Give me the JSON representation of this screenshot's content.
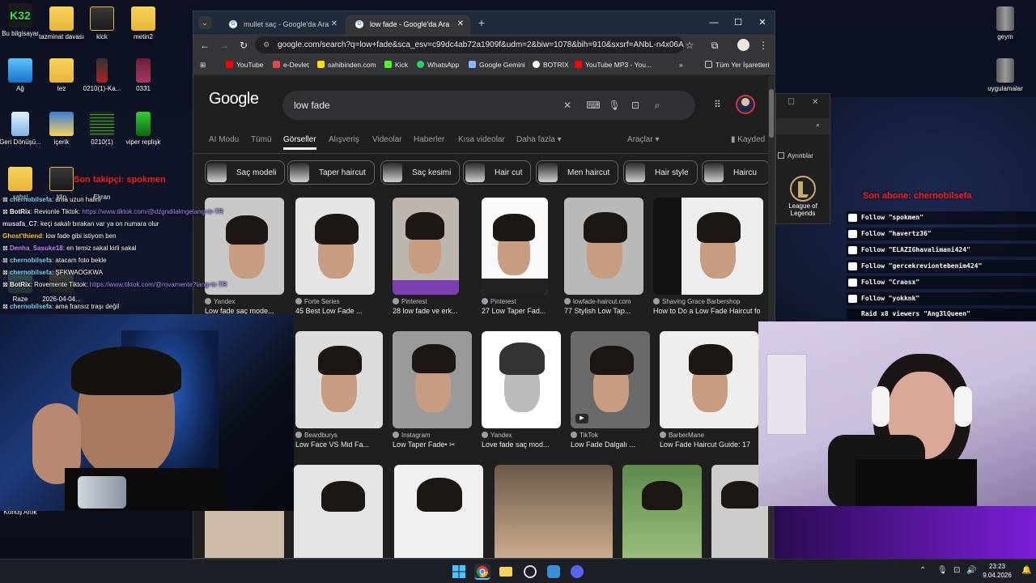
{
  "desktop": {
    "icons_left": [
      {
        "label": "Bu bilgisayar",
        "name": "pc"
      },
      {
        "label": "tazminat davası",
        "name": "folder"
      },
      {
        "label": "kick",
        "name": "folder"
      },
      {
        "label": "metin2",
        "name": "folder"
      },
      {
        "label": "Ağ",
        "name": "network"
      },
      {
        "label": "tez",
        "name": "folder"
      },
      {
        "label": "0210(1)-Ka...",
        "name": "file"
      },
      {
        "label": "0331",
        "name": "file"
      },
      {
        "label": "Geri Dönüşü...",
        "name": "bin"
      },
      {
        "label": "içerik",
        "name": "folder"
      },
      {
        "label": "0210(1)",
        "name": "file"
      },
      {
        "label": "viper replişk",
        "name": "file"
      },
      {
        "label": "şahsi",
        "name": "folder"
      },
      {
        "label": "klip",
        "name": "folder"
      },
      {
        "label": "Ekran",
        "name": "folder"
      },
      {
        "label": "Raze",
        "name": "file"
      },
      {
        "label": "2026-04-04...",
        "name": "file"
      },
      {
        "label": "Konuş Artık",
        "name": "file"
      }
    ],
    "icons_right": [
      {
        "label": "geym"
      },
      {
        "label": "uygulamalar"
      }
    ],
    "k32_logo": "K32"
  },
  "browser": {
    "tabs": [
      {
        "title": "mullet saç - Google'da Ara",
        "active": false
      },
      {
        "title": "low fade - Google'da Ara",
        "active": true
      }
    ],
    "url": "google.com/search?q=low+fade&sca_esv=c99dc4ab72a1909f&udm=2&biw=1078&bih=910&sxsrf=ANbL-n4x06AgC...",
    "bookmarks": [
      {
        "label": "YouTube",
        "color": "#ff0000"
      },
      {
        "label": "e-Devlet",
        "color": "#e04848"
      },
      {
        "label": "sahibinden.com",
        "color": "#ffe000"
      },
      {
        "label": "Kick",
        "color": "#53fc18"
      },
      {
        "label": "WhatsApp",
        "color": "#25d366"
      },
      {
        "label": "Google Gemini",
        "color": "#8ab4f8"
      },
      {
        "label": "BOTRİX",
        "color": "#ffffff"
      },
      {
        "label": "YouTube MP3 - You...",
        "color": "#ff0000"
      }
    ],
    "bookmarks_folder": "Tüm Yer İşaretleri"
  },
  "google": {
    "logo": "Google",
    "query": "low fade",
    "tabs": [
      "AI Modu",
      "Tümü",
      "Görseller",
      "Alışveriş",
      "Videolar",
      "Haberler",
      "Kısa videolar",
      "Daha fazla",
      "Araçlar"
    ],
    "selected_tab": "Görseller",
    "saved_label": "Kayded",
    "chips": [
      "Saç modeli",
      "Taper haircut",
      "Saç kesimi",
      "Hair cut",
      "Men haircut",
      "Hair style",
      "Haircu"
    ],
    "row1": [
      {
        "source": "Yandex",
        "title": "Low fade saç mode..."
      },
      {
        "source": "Forte Series",
        "title": "45 Best Low Fade ..."
      },
      {
        "source": "Pinterest",
        "title": "28 low fade ve erk..."
      },
      {
        "source": "Pinterest",
        "title": "27 Low Taper Fad..."
      },
      {
        "source": "lowfade-haircut.com",
        "title": "77 Stylish Low Tap..."
      },
      {
        "source": "Shaving Grace Barbershop",
        "title": "How to Do a Low Fade Haircut fo"
      }
    ],
    "row2": [
      {
        "source": "Beardburys",
        "title": "Low Face VS Mid Fa..."
      },
      {
        "source": "Instagram",
        "title": "Low Taper Fade• ✂"
      },
      {
        "source": "Yandex",
        "title": "Love fade saç mod..."
      },
      {
        "source": "TikTok",
        "title": "Low Fade Dalgalı ..."
      },
      {
        "source": "BarberMane",
        "title": "Low Fade Haircut Guide: 17"
      }
    ]
  },
  "explorer": {
    "details_label": "Ayrıntılar",
    "app_label": "League of Legends"
  },
  "overlay": {
    "last_follow": "Son takipçi: spokmen",
    "last_sub": "Son abone: chernobilsefa",
    "chat": [
      {
        "user": "chernobilsefa",
        "text": ": ama uzun halini",
        "link": ""
      },
      {
        "user": "BotRix",
        "text": ": Revionte Tiktok: ",
        "link": "https://www.tiktok.com/@dzgndilalmgelang=tr-TR"
      },
      {
        "user": "musafa_C7",
        "text": ": keçi sakalı bırakan var ya on numara olur",
        "link": ""
      },
      {
        "user": "Ghost'thiend",
        "text": ": low fade gibi istiyom ben",
        "link": ""
      },
      {
        "user": "Denha_Sasuke18",
        "text": ": en temiz sakal kirli sakal",
        "link": ""
      },
      {
        "user": "chernobilsefa",
        "text": ": atacam foto bekle",
        "link": ""
      },
      {
        "user": "chernobilsefa",
        "text": ": ŞFKWAOGKWA",
        "link": ""
      },
      {
        "user": "BotRix",
        "text": ": Rovemente Tiktok: ",
        "link": "https://www.tiktok.com/@rovamente?lang=tr-TR"
      },
      {
        "user": "chernobilsefa",
        "text": ": ama fransız traşı değil",
        "link": ""
      }
    ],
    "follows": [
      "Follow \"spokmen\"",
      "Follow \"havertz36\"",
      "Follow \"ELAZIGhavalimani424\"",
      "Follow \"gercekreviontebenim424\"",
      "Follow \"Craosx\"",
      "Follow \"yokknk\"",
      "Raid x8 viewers \"Ang3lQueen\""
    ]
  },
  "taskbar": {
    "time": "23:23",
    "date": "9.04.2026"
  }
}
